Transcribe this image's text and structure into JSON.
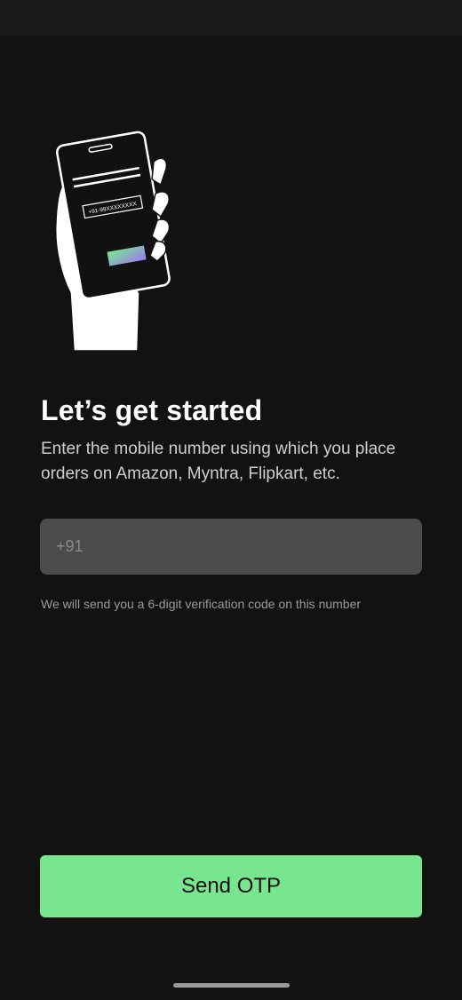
{
  "illustration": {
    "icon": "hand-holding-phone-illustration",
    "phone_number_sample": "+91-99XXXXXXXX"
  },
  "main": {
    "title": "Let’s get started",
    "subtitle": "Enter the mobile number using which you place orders on Amazon, Myntra, Flipkart, etc.",
    "phone_input": {
      "value": "",
      "placeholder": "+91"
    },
    "helper_text": "We will send you a 6-digit verification code on this number",
    "send_button_label": "Send OTP"
  },
  "colors": {
    "background": "#121212",
    "accent": "#77e68f",
    "input_background": "#4b4b4b"
  }
}
